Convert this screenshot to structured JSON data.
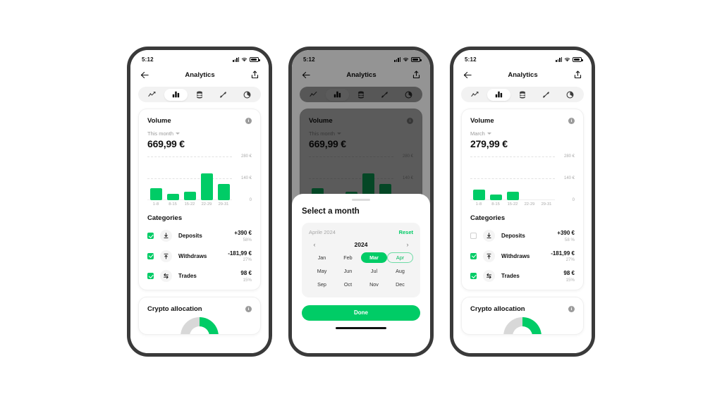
{
  "status_bar": {
    "time": "5:12",
    "signal_icon": "cellular-signal-icon",
    "wifi_icon": "wifi-icon",
    "battery_icon": "battery-icon"
  },
  "nav": {
    "back_icon": "back-arrow-icon",
    "title": "Analytics",
    "share_icon": "share-upload-icon"
  },
  "tabs": [
    {
      "icon": "line-chart-icon",
      "name": "tab-performance"
    },
    {
      "icon": "bar-chart-icon",
      "name": "tab-volume"
    },
    {
      "icon": "coins-stack-icon",
      "name": "tab-balance"
    },
    {
      "icon": "candlestick-icon",
      "name": "tab-trades"
    },
    {
      "icon": "pie-chart-icon",
      "name": "tab-allocation"
    }
  ],
  "volume_card": {
    "title": "Volume",
    "info_icon": "info-icon",
    "info_glyph": "i",
    "period_default": "This month",
    "period_march": "March",
    "amount_default": "669,99 €",
    "amount_march": "279,99 €",
    "chevron_icon": "chevron-down-icon"
  },
  "chart_data": {
    "type": "bar",
    "title": "Volume",
    "categories": [
      "1-8",
      "8-15",
      "15-22",
      "22-29",
      "29-31"
    ],
    "ylabel": "",
    "xlabel": "",
    "ylim": [
      0,
      280
    ],
    "yticks": [
      280,
      140,
      0
    ],
    "ytick_labels": [
      "280 €",
      "140 €",
      "0"
    ],
    "grid": true,
    "bar_color": "#00cc66",
    "series": [
      {
        "name": "This month",
        "values": [
          75,
          40,
          55,
          170,
          105
        ],
        "total": "669,99 €"
      },
      {
        "name": "March",
        "values": [
          70,
          38,
          55,
          0,
          0
        ],
        "total": "279,99 €"
      }
    ]
  },
  "categories_section": {
    "title": "Categories",
    "items": [
      {
        "label": "Deposits",
        "icon": "download-arrow-icon",
        "amount": "+390 €",
        "percent": "58%",
        "percent_alt": "58 %",
        "checked_default": true,
        "checked_march": false
      },
      {
        "label": "Withdraws",
        "icon": "upload-arrow-icon",
        "amount": "-181,99 €",
        "percent": "27%",
        "percent_alt": "27%",
        "checked_default": true,
        "checked_march": true
      },
      {
        "label": "Trades",
        "icon": "swap-arrows-icon",
        "amount": "98 €",
        "percent": "15%",
        "percent_alt": "15%",
        "checked_default": true,
        "checked_march": true
      }
    ]
  },
  "crypto_card": {
    "title": "Crypto allocation",
    "info_icon": "info-icon",
    "info_glyph": "i",
    "donut_icon": "donut-chart-icon"
  },
  "month_sheet": {
    "grabber": "sheet-grabber",
    "title": "Select a month",
    "current_label": "Aprile 2024",
    "reset_label": "Reset",
    "prev_icon": "chevron-left-icon",
    "prev_glyph": "‹",
    "year": "2024",
    "next_icon": "chevron-right-icon",
    "next_glyph": "›",
    "months": [
      "Jan",
      "Feb",
      "Mar",
      "Apr",
      "May",
      "Jun",
      "Jul",
      "Aug",
      "Sep",
      "Oct",
      "Nov",
      "Dec"
    ],
    "selected_month": "Mar",
    "current_month": "Apr",
    "done_label": "Done"
  },
  "colors": {
    "accent": "#00cc66",
    "accent_outline": "#6fdca6",
    "text": "#111111",
    "muted": "#a8a8a8",
    "card_bg": "#ffffff",
    "pill_bg": "#f2f2f2",
    "scrim": "rgba(0,0,0,0.42)"
  }
}
